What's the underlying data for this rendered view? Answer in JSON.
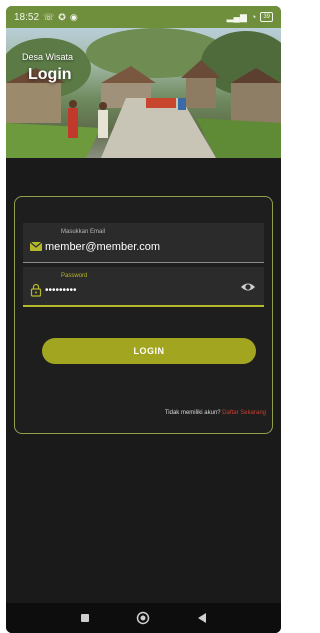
{
  "status_bar": {
    "time": "18:52",
    "left_icons": [
      "call-icon",
      "accessibility-icon",
      "notification-icon"
    ],
    "right_icons": [
      "signal-icon",
      "wifi-icon"
    ],
    "battery_level": "39"
  },
  "hero": {
    "subtitle": "Desa Wisata",
    "title": "Login"
  },
  "login_form": {
    "email": {
      "label": "Masukkan Email",
      "value": "member@member.com",
      "icon": "email-icon"
    },
    "password": {
      "label": "Password",
      "value": "•••••••••",
      "icon": "lock-icon",
      "toggle_icon": "eye-icon"
    },
    "login_button": "LOGIN",
    "signup_prompt": "Tidak memiliki akun?",
    "signup_link": "Daftar Sekarang"
  },
  "nav_bar": {
    "buttons": [
      "recent-apps-icon",
      "home-icon",
      "back-icon"
    ]
  },
  "colors": {
    "status_bar": "#6f8f3c",
    "accent": "#a2a51f",
    "card_border": "#8fa24a",
    "background": "#1a1a1a",
    "signup_link": "#d23b2f"
  }
}
